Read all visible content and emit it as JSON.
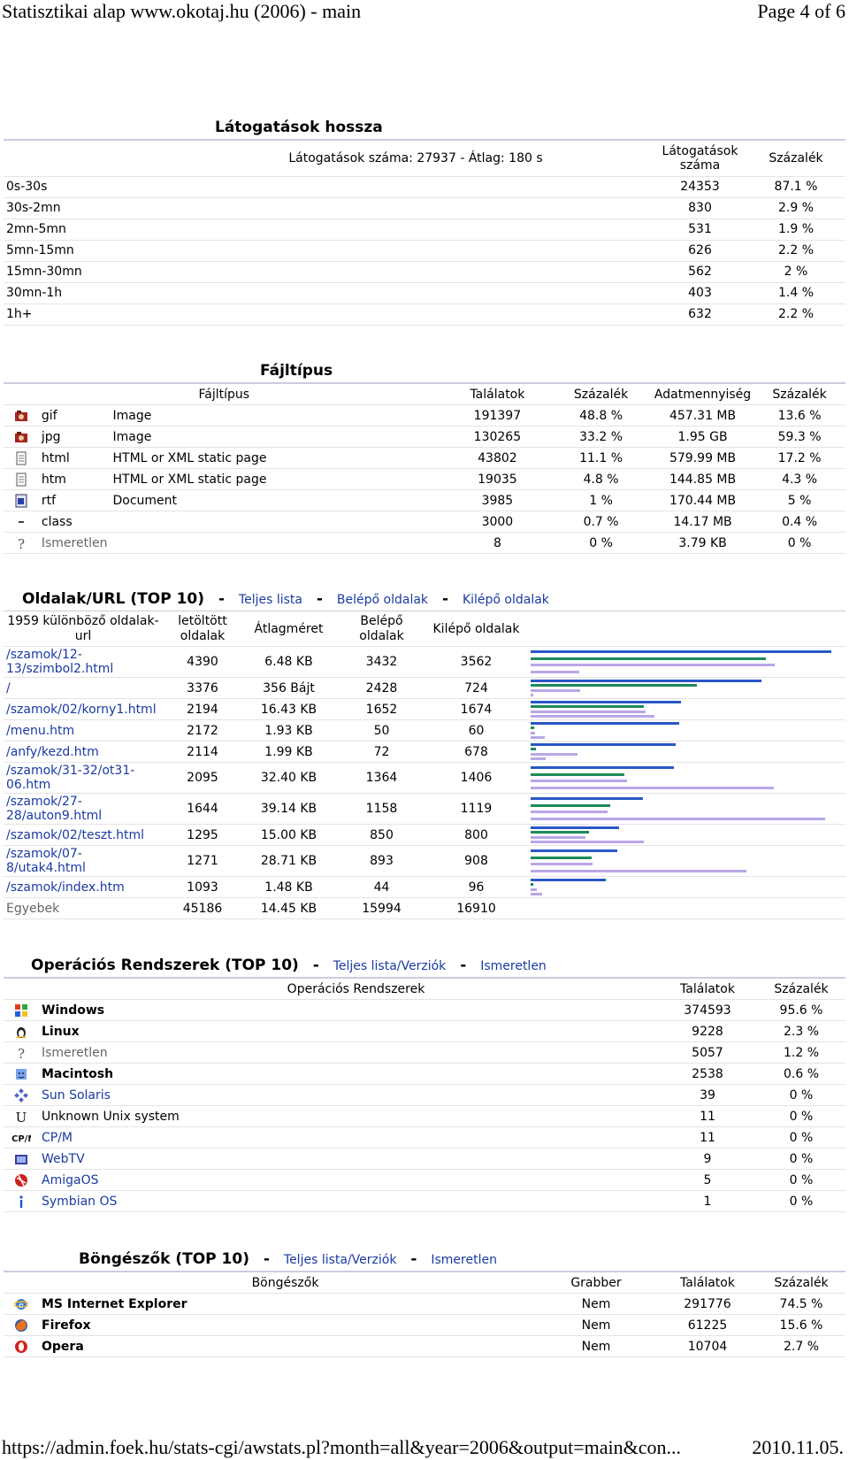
{
  "header": {
    "left": "Statisztikai alap www.okotaj.hu (2006) - main",
    "right": "Page 4 of 6"
  },
  "footer": {
    "left": "https://admin.foek.hu/stats-cgi/awstats.pl?month=all&year=2006&output=main&con...",
    "right": "2010.11.05."
  },
  "visits": {
    "title": "Látogatások hossza",
    "summary": "Látogatások száma: 27937 - Átlag: 180 s",
    "col_visits": "Látogatások száma",
    "col_percent": "Százalék",
    "rows": [
      {
        "range": "0s-30s",
        "count": "24353",
        "pct": "87.1 %"
      },
      {
        "range": "30s-2mn",
        "count": "830",
        "pct": "2.9 %"
      },
      {
        "range": "2mn-5mn",
        "count": "531",
        "pct": "1.9 %"
      },
      {
        "range": "5mn-15mn",
        "count": "626",
        "pct": "2.2 %"
      },
      {
        "range": "15mn-30mn",
        "count": "562",
        "pct": "2 %"
      },
      {
        "range": "30mn-1h",
        "count": "403",
        "pct": "1.4 %"
      },
      {
        "range": "1h+",
        "count": "632",
        "pct": "2.2 %"
      }
    ]
  },
  "filetypes": {
    "title": "Fájltípus",
    "cols": [
      "Fájltípus",
      "Találatok",
      "Százalék",
      "Adatmennyiség",
      "Százalék"
    ],
    "rows": [
      {
        "icon": "image-icon",
        "ext": "gif",
        "desc": "Image",
        "hits": "191397",
        "hpct": "48.8 %",
        "size": "457.31 MB",
        "spct": "13.6 %"
      },
      {
        "icon": "image-icon",
        "ext": "jpg",
        "desc": "Image",
        "hits": "130265",
        "hpct": "33.2 %",
        "size": "1.95 GB",
        "spct": "59.3 %"
      },
      {
        "icon": "html-page-icon",
        "ext": "html",
        "desc": "HTML or XML static page",
        "hits": "43802",
        "hpct": "11.1 %",
        "size": "579.99 MB",
        "spct": "17.2 %"
      },
      {
        "icon": "html-page-icon",
        "ext": "htm",
        "desc": "HTML or XML static page",
        "hits": "19035",
        "hpct": "4.8 %",
        "size": "144.85 MB",
        "spct": "4.3 %"
      },
      {
        "icon": "document-icon",
        "ext": "rtf",
        "desc": "Document",
        "hits": "3985",
        "hpct": "1 %",
        "size": "170.44 MB",
        "spct": "5 %"
      },
      {
        "icon": "dash-icon",
        "ext": "class",
        "desc": "",
        "hits": "3000",
        "hpct": "0.7 %",
        "size": "14.17 MB",
        "spct": "0.4 %"
      },
      {
        "icon": "unknown-icon",
        "ext": "Ismeretlen",
        "desc": "",
        "hits": "8",
        "hpct": "0 %",
        "size": "3.79 KB",
        "spct": "0 %"
      }
    ]
  },
  "pages": {
    "title": "Oldalak/URL (TOP 10)",
    "link_full": "Teljes lista",
    "link_entry": "Belépő oldalak",
    "link_exit": "Kilépő oldalak",
    "cols": [
      "1959 különböző oldalak-url",
      "letöltött oldalak",
      "Átlagméret",
      "Belépő oldalak",
      "Kilépő oldalak"
    ],
    "rows": [
      {
        "url": "/szamok/12-13/szimbol2.html",
        "views": "4390",
        "avg": "6.48 KB",
        "entry": "3432",
        "exit": "3562"
      },
      {
        "url": "/",
        "views": "3376",
        "avg": "356 Bájt",
        "entry": "2428",
        "exit": "724"
      },
      {
        "url": "/szamok/02/korny1.html",
        "views": "2194",
        "avg": "16.43 KB",
        "entry": "1652",
        "exit": "1674"
      },
      {
        "url": "/menu.htm",
        "views": "2172",
        "avg": "1.93 KB",
        "entry": "50",
        "exit": "60"
      },
      {
        "url": "/anfy/kezd.htm",
        "views": "2114",
        "avg": "1.99 KB",
        "entry": "72",
        "exit": "678"
      },
      {
        "url": "/szamok/31-32/ot31-06.htm",
        "views": "2095",
        "avg": "32.40 KB",
        "entry": "1364",
        "exit": "1406"
      },
      {
        "url": "/szamok/27-28/auton9.html",
        "views": "1644",
        "avg": "39.14 KB",
        "entry": "1158",
        "exit": "1119"
      },
      {
        "url": "/szamok/02/teszt.html",
        "views": "1295",
        "avg": "15.00 KB",
        "entry": "850",
        "exit": "800"
      },
      {
        "url": "/szamok/07-8/utak4.html",
        "views": "1271",
        "avg": "28.71 KB",
        "entry": "893",
        "exit": "908"
      },
      {
        "url": "/szamok/index.htm",
        "views": "1093",
        "avg": "1.48 KB",
        "entry": "44",
        "exit": "96"
      },
      {
        "url": "Egyebek",
        "views": "45186",
        "avg": "14.45 KB",
        "entry": "15994",
        "exit": "16910"
      }
    ]
  },
  "os": {
    "title": "Operációs Rendszerek (TOP 10)",
    "link_full": "Teljes lista/Verziók",
    "link_unknown": "Ismeretlen",
    "cols": [
      "Operációs Rendszerek",
      "Találatok",
      "Százalék"
    ],
    "rows": [
      {
        "icon": "windows-icon",
        "name": "Windows",
        "hits": "374593",
        "pct": "95.6 %",
        "style": "b"
      },
      {
        "icon": "linux-icon",
        "name": "Linux",
        "hits": "9228",
        "pct": "2.3 %",
        "style": "b"
      },
      {
        "icon": "unknown-icon",
        "name": "Ismeretlen",
        "hits": "5057",
        "pct": "1.2 %",
        "style": "grey"
      },
      {
        "icon": "macintosh-icon",
        "name": "Macintosh",
        "hits": "2538",
        "pct": "0.6 %",
        "style": "b"
      },
      {
        "icon": "sun-solaris-icon",
        "name": "Sun Solaris",
        "hits": "39",
        "pct": "0 %",
        "style": "lnk"
      },
      {
        "icon": "unix-icon",
        "name": "Unknown Unix system",
        "hits": "11",
        "pct": "0 %",
        "style": ""
      },
      {
        "icon": "cpm-icon",
        "name": "CP/M",
        "hits": "11",
        "pct": "0 %",
        "style": "lnk"
      },
      {
        "icon": "webtv-icon",
        "name": "WebTV",
        "hits": "9",
        "pct": "0 %",
        "style": "lnk"
      },
      {
        "icon": "amigaos-icon",
        "name": "AmigaOS",
        "hits": "5",
        "pct": "0 %",
        "style": "lnk"
      },
      {
        "icon": "symbian-icon",
        "name": "Symbian OS",
        "hits": "1",
        "pct": "0 %",
        "style": "lnk"
      }
    ]
  },
  "browsers": {
    "title": "Böngészők (TOP 10)",
    "link_full": "Teljes lista/Verziók",
    "link_unknown": "Ismeretlen",
    "cols": [
      "Böngészők",
      "Grabber",
      "Találatok",
      "Százalék"
    ],
    "rows": [
      {
        "icon": "ie-icon",
        "name": "MS Internet Explorer",
        "grabber": "Nem",
        "hits": "291776",
        "pct": "74.5 %"
      },
      {
        "icon": "firefox-icon",
        "name": "Firefox",
        "grabber": "Nem",
        "hits": "61225",
        "pct": "15.6 %"
      },
      {
        "icon": "opera-icon",
        "name": "Opera",
        "grabber": "Nem",
        "hits": "10704",
        "pct": "2.7 %"
      }
    ]
  },
  "colors": {
    "bar_blue": "#2a57c8",
    "bar_green": "#1c8a5a",
    "bar_lilac": "#b9a6e8",
    "link": "#1a3aa0"
  }
}
